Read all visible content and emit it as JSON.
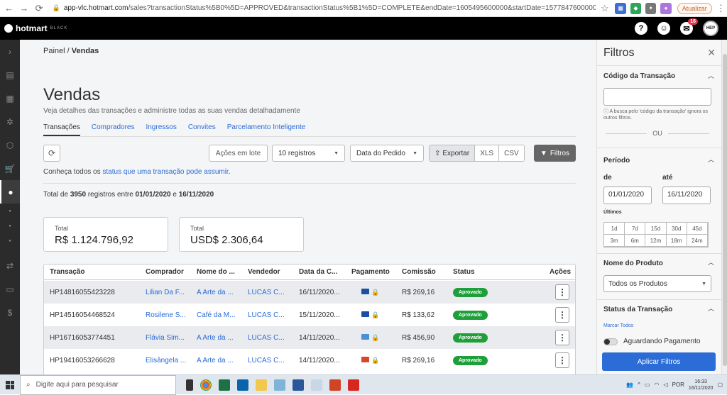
{
  "browser": {
    "url_host": "app-vlc.hotmart.com",
    "url_path": "/sales?transactionStatus%5B0%5D=APPROVED&transactionStatus%5B1%5D=COMPLETE&endDate=1605495600000&startDate=1577847600000",
    "update_label": "Atualizar"
  },
  "topbar": {
    "logo": "hotmart",
    "logo_sub": "BLACK",
    "help": "?",
    "notifications": "16",
    "avatar": "HEP"
  },
  "breadcrumb": {
    "root": "Painel",
    "sep": "/",
    "current": "Vendas"
  },
  "page": {
    "title": "Vendas",
    "subtitle": "Veja detalhes das transações e administre todas as suas vendas detalhadamente"
  },
  "tabs": [
    "Transações",
    "Compradores",
    "Ingressos",
    "Convites",
    "Parcelamento Inteligente"
  ],
  "toolbar": {
    "batch": "Ações em lote",
    "records": "10 registros",
    "date_type": "Data do Pedido",
    "export": "Exportar",
    "xls": "XLS",
    "csv": "CSV",
    "filters": "Filtros"
  },
  "info": {
    "before": "Conheça todos os ",
    "link": "status que uma transação pode assumir",
    "after": "."
  },
  "total_line": {
    "a": "Total de ",
    "count": "3950",
    "b": " registros entre ",
    "start": "01/01/2020",
    "c": " e ",
    "end": "16/11/2020"
  },
  "cards": [
    {
      "label": "Total",
      "value": "R$ 1.124.796,92"
    },
    {
      "label": "Total",
      "value": "USD$ 2.306,64"
    }
  ],
  "table": {
    "headers": [
      "Transação",
      "Comprador",
      "Nome do ...",
      "Vendedor",
      "Data da C...",
      "Pagamento",
      "Comissão",
      "Status",
      "Ações"
    ],
    "rows": [
      {
        "id": "HP14816055423228",
        "buyer": "Lilian Da F...",
        "product": "A Arte da ...",
        "seller": "LUCAS C...",
        "date": "16/11/2020...",
        "commission": "R$ 269,16",
        "status": "Aprovado"
      },
      {
        "id": "HP14516054468524",
        "buyer": "Rosilene S...",
        "product": "Café da M...",
        "seller": "LUCAS C...",
        "date": "15/11/2020...",
        "commission": "R$ 133,62",
        "status": "Aprovado"
      },
      {
        "id": "HP16716053774451",
        "buyer": "Flávia Sim...",
        "product": "A Arte da ...",
        "seller": "LUCAS C...",
        "date": "14/11/2020...",
        "commission": "R$ 456,90",
        "status": "Aprovado"
      },
      {
        "id": "HP19416053266628",
        "buyer": "Elisângela ...",
        "product": "A Arte da ...",
        "seller": "LUCAS C...",
        "date": "14/11/2020...",
        "commission": "R$ 269,16",
        "status": "Aprovado"
      }
    ]
  },
  "filters": {
    "title": "Filtros",
    "code_title": "Código da Transação",
    "code_value": "",
    "code_hint": "ⓘ A busca pelo 'código da transação' ignora os outros filtros.",
    "or": "OU",
    "period_title": "Período",
    "from_label": "de",
    "to_label": "até",
    "from_value": "01/01/2020",
    "to_value": "16/11/2020",
    "last_label": "Últimos",
    "periods": [
      "1d",
      "7d",
      "15d",
      "30d",
      "45d",
      "3m",
      "6m",
      "12m",
      "18m",
      "24m"
    ],
    "product_title": "Nome do Produto",
    "product_value": "Todos os Produtos",
    "status_title": "Status da Transação",
    "mark_all": "Marcar Todos",
    "status_option": "Aguardando Pagamento",
    "apply": "Aplicar Filtros"
  },
  "taskbar": {
    "search": "Digite aqui para pesquisar",
    "lang": "POR",
    "time": "16:33",
    "date": "16/11/2020"
  },
  "colors": {
    "link": "#2b6cd6",
    "approved": "#1f9f39",
    "topbar": "#000000",
    "apply": "#2b6cd6"
  }
}
